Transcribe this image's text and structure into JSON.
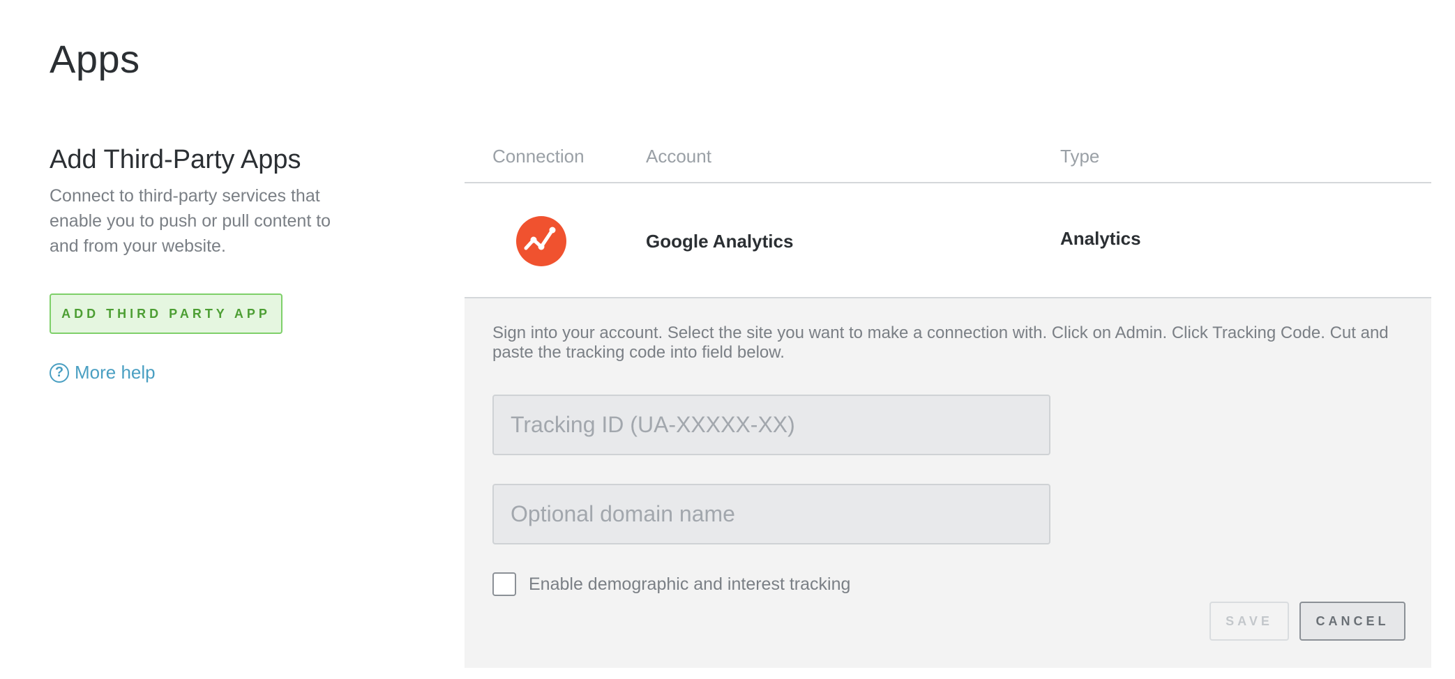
{
  "page": {
    "title": "Apps"
  },
  "sidebar": {
    "title": "Add Third-Party Apps",
    "description": "Connect to third-party services that enable you to push or pull content to and from your website.",
    "add_button_label": "ADD THIRD PARTY APP",
    "help_icon_glyph": "?",
    "help_link_label": "More help"
  },
  "table": {
    "headers": {
      "connection": "Connection",
      "account": "Account",
      "type": "Type"
    },
    "row": {
      "icon": "google-analytics-icon",
      "icon_color": "#f0522f",
      "account": "Google Analytics",
      "type": "Analytics"
    }
  },
  "config": {
    "instructions": "Sign into your account. Select the site you want to make a connection with. Click on Admin. Click Tracking Code. Cut and paste the tracking code into field below.",
    "tracking_id": {
      "value": "",
      "placeholder": "Tracking ID (UA-XXXXX-XX)"
    },
    "domain": {
      "value": "",
      "placeholder": "Optional domain name"
    },
    "demographic_checkbox": {
      "checked": false,
      "label": "Enable demographic and interest tracking"
    },
    "save_label": "SAVE",
    "cancel_label": "CANCEL"
  },
  "colors": {
    "accent_green": "#7ed069",
    "link_blue": "#4a9fc2",
    "panel_bg": "#f3f3f3"
  }
}
